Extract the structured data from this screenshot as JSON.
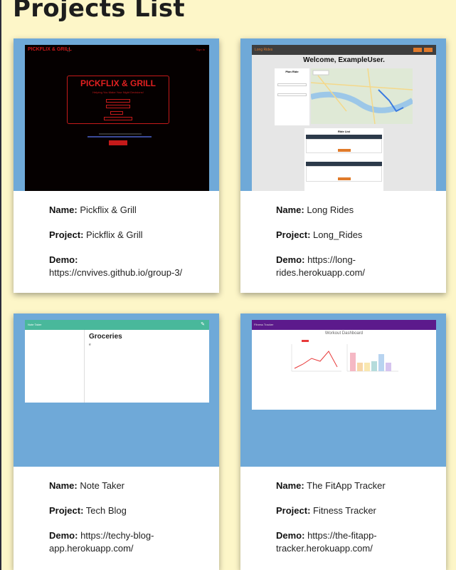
{
  "page": {
    "title": "Projects List"
  },
  "labels": {
    "name": "Name:",
    "project": "Project:",
    "demo": "Demo:"
  },
  "cards": [
    {
      "name": "Pickflix & Grill",
      "project": "Pickflix & Grill",
      "demo_line1": "",
      "demo_line2": "https://cnvives.github.io/group-3/",
      "screenshot": {
        "brand": "PICKFLIX & GRILL",
        "signin": "Sign In",
        "title": "PICKFLIX & GRILL",
        "subtitle": "Helping You Make Your Night Decisions!",
        "accent": "#c51a1a"
      }
    },
    {
      "name": "Long Rides",
      "project": "Long_Rides",
      "demo_line1": "https://long-",
      "demo_line2": "rides.herokuapp.com/",
      "screenshot": {
        "logo": "Long Rides",
        "welcome": "Welcome, ExampleUser.",
        "form_title": "Plan Ride",
        "list_title": "Ride List",
        "accent": "#e07a2a"
      }
    },
    {
      "name": "Note Taker",
      "project": "Tech Blog",
      "demo_line1": "https://techy-blog-",
      "demo_line2": "app.herokuapp.com/",
      "screenshot": {
        "app_title": "Note Taker",
        "note_title": "Groceries",
        "note_body": "e",
        "accent": "#49b89b"
      }
    },
    {
      "name": "The FitApp Tracker",
      "project": "Fitness Tracker",
      "demo_line1": "https://the-fitapp-",
      "demo_line2": "tracker.herokuapp.com/",
      "screenshot": {
        "app_title": "Fitness Tracker",
        "dashboard_title": "Workout Dashboard",
        "accent": "#5c1a8c"
      }
    }
  ]
}
